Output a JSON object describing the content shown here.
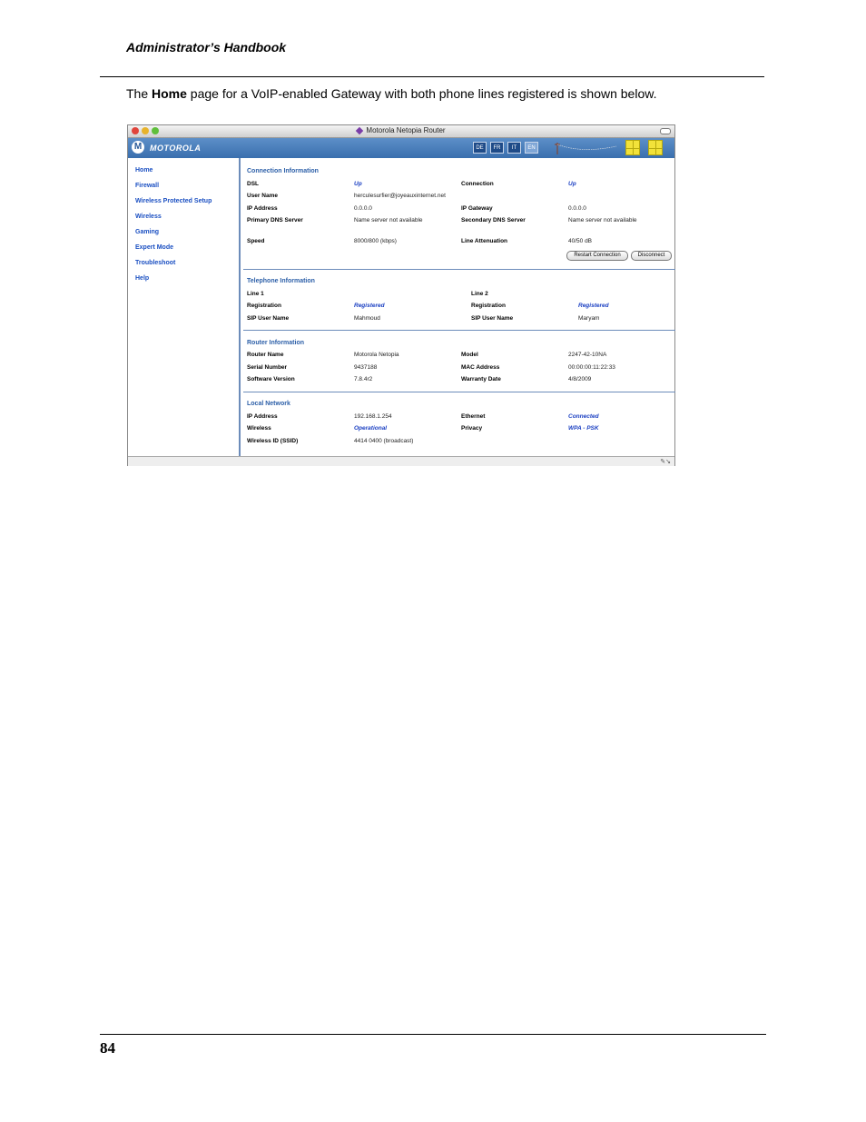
{
  "doc": {
    "header": "Administrator’s Handbook",
    "intro_pre": "The ",
    "intro_bold": "Home",
    "intro_post": " page for a VoIP-enabled Gateway with both phone lines registered is shown below.",
    "page_number": "84"
  },
  "window": {
    "title": "Motorola Netopia Router",
    "brand": "MOTOROLA",
    "languages": [
      "DE",
      "FR",
      "IT",
      "EN"
    ]
  },
  "nav": [
    "Home",
    "Firewall",
    "Wireless Protected Setup",
    "Wireless",
    "Gaming",
    "Expert Mode",
    "Troubleshoot",
    "Help"
  ],
  "connection": {
    "title": "Connection Information",
    "dsl_label": "DSL",
    "dsl": "Up",
    "connection_label": "Connection",
    "connection": "Up",
    "user_label": "User Name",
    "user": "herculesurfier@joyeauxinternet.net",
    "ip_label": "IP Address",
    "ip": "0.0.0.0",
    "gw_label": "IP Gateway",
    "gw": "0.0.0.0",
    "pdns_label": "Primary DNS Server",
    "pdns": "Name server not available",
    "sdns_label": "Secondary DNS Server",
    "sdns": "Name server not available",
    "speed_label": "Speed",
    "speed": "8000/800 (kbps)",
    "atten_label": "Line Attenuation",
    "atten": "40/50 dB",
    "restart_btn": "Restart Connection",
    "disconnect_btn": "Disconnect"
  },
  "telephone": {
    "title": "Telephone Information",
    "line1": "Line 1",
    "line2": "Line 2",
    "reg_label": "Registration",
    "reg1": "Registered",
    "reg2": "Registered",
    "sip_label": "SIP User Name",
    "sip1": "Mahmoud",
    "sip2": "Maryam"
  },
  "router": {
    "title": "Router Information",
    "name_label": "Router Name",
    "name": "Motorola Netopia",
    "model_label": "Model",
    "model": "2247-42-10NA",
    "serial_label": "Serial Number",
    "serial": "9437188",
    "mac_label": "MAC Address",
    "mac": "00:00:00:11:22:33",
    "sw_label": "Software Version",
    "sw": "7.8.4r2",
    "warranty_label": "Warranty Date",
    "warranty": "4/8/2009"
  },
  "local": {
    "title": "Local Network",
    "ip_label": "IP Address",
    "ip": "192.168.1.254",
    "eth_label": "Ethernet",
    "eth": "Connected",
    "wl_label": "Wireless",
    "wl": "Operational",
    "priv_label": "Privacy",
    "priv": "WPA - PSK",
    "ssid_label": "Wireless ID (SSID)",
    "ssid": "4414 0400 (broadcast)"
  }
}
